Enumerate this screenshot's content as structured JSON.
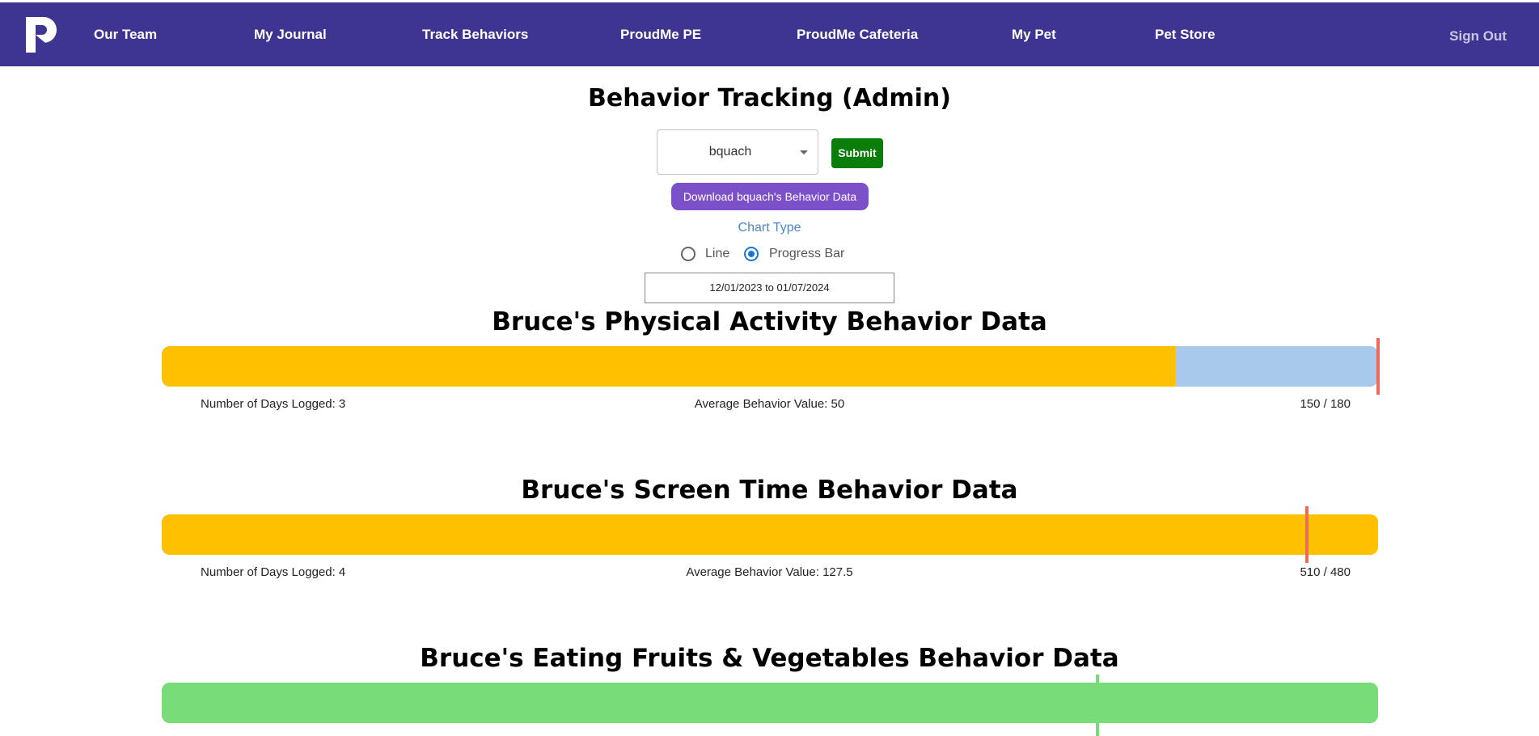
{
  "nav": {
    "items": [
      {
        "label": "Our Team"
      },
      {
        "label": "My Journal"
      },
      {
        "label": "Track Behaviors"
      },
      {
        "label": "ProudMe PE"
      },
      {
        "label": "ProudMe Cafeteria"
      },
      {
        "label": "My Pet"
      },
      {
        "label": "Pet Store"
      }
    ],
    "sign_out": "Sign Out",
    "logo_icon": "proudme-logo-icon"
  },
  "page": {
    "title": "Behavior Tracking (Admin)"
  },
  "controls": {
    "selected_user": "bquach",
    "submit_label": "Submit",
    "download_label": "Download bquach's Behavior Data",
    "chart_type_label": "Chart Type",
    "chart_type_options": [
      {
        "label": "Line",
        "selected": false
      },
      {
        "label": "Progress Bar",
        "selected": true
      }
    ],
    "date_range": "12/01/2023 to 01/07/2024"
  },
  "sections": [
    {
      "title": "Bruce's Physical Activity Behavior Data",
      "days_logged": "Number of Days Logged: 3",
      "average": "Average Behavior Value: 50",
      "progress_text": "150 / 180",
      "value": 150,
      "goal": 180,
      "fill_color": "#ffc000",
      "track_color": "#a8c8ec",
      "marker_color": "#f06a5a"
    },
    {
      "title": "Bruce's Screen Time Behavior Data",
      "days_logged": "Number of Days Logged: 4",
      "average": "Average Behavior Value: 127.5",
      "progress_text": "510 / 480",
      "value": 510,
      "goal": 480,
      "fill_color": "#ffc000",
      "track_color": "#ffc000",
      "marker_color": "#f06a5a"
    },
    {
      "title": "Bruce's Eating Fruits & Vegetables Behavior Data",
      "fill_color": "#78dc78",
      "track_color": "#78dc78",
      "marker_color": "#78dc78"
    }
  ],
  "colors": {
    "navbar": "#3e3592",
    "submit": "#0a7d0a",
    "download": "#7c50c8",
    "radio_selected": "#1976d2"
  }
}
